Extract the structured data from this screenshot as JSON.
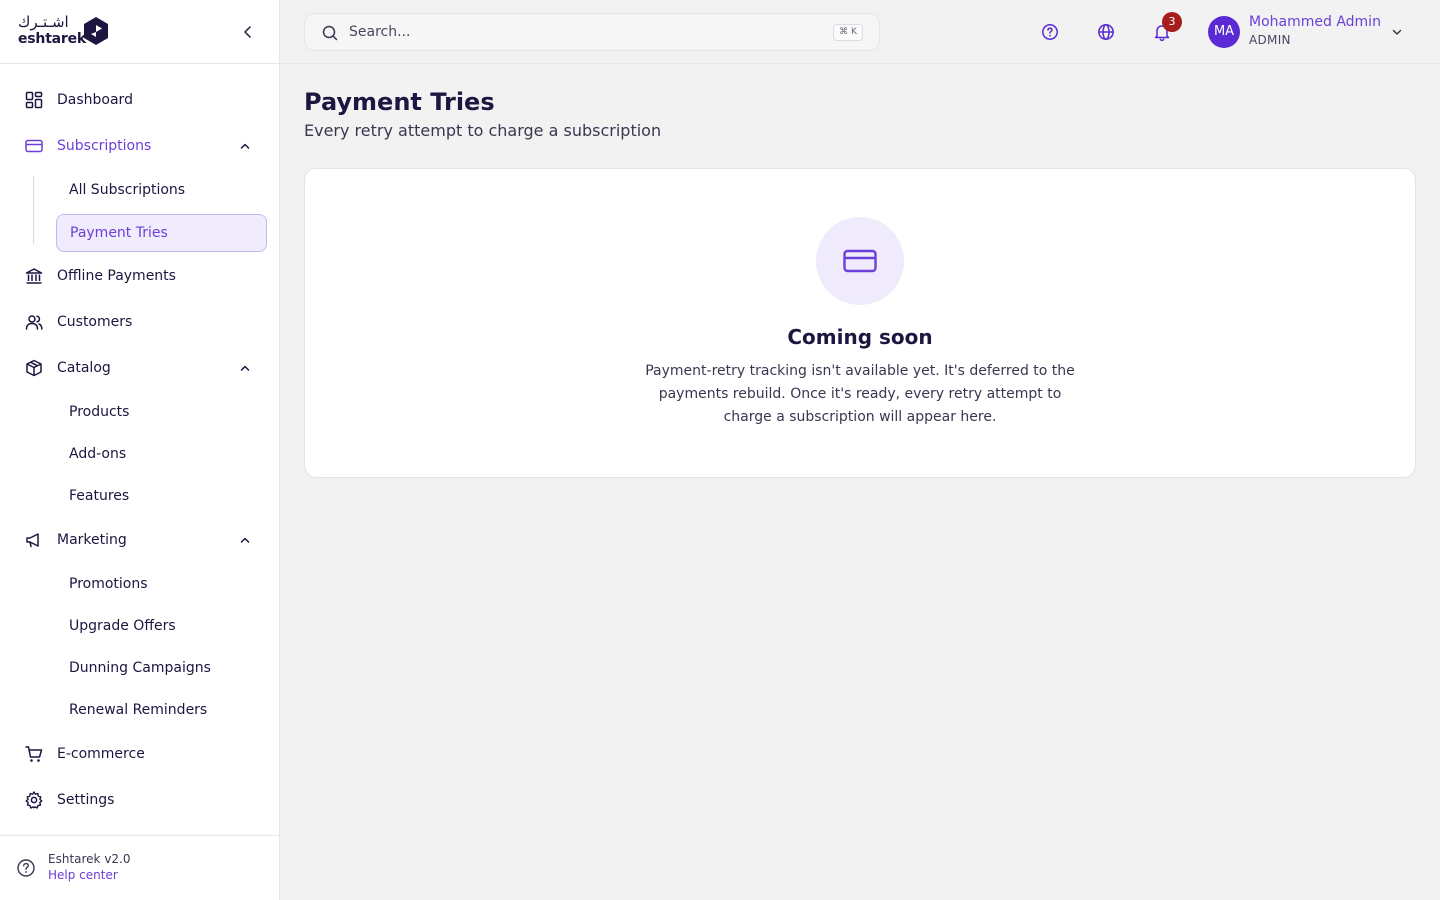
{
  "brand": {
    "arabic": "اشـتـرك",
    "latin": "eshtarek"
  },
  "sidebar": {
    "items": [
      {
        "label": "Dashboard",
        "icon": "dashboard-grid-icon"
      },
      {
        "label": "Subscriptions",
        "icon": "credit-card-icon",
        "expanded": true,
        "children": [
          {
            "label": "All Subscriptions"
          },
          {
            "label": "Payment Tries",
            "active": true
          }
        ]
      },
      {
        "label": "Offline Payments",
        "icon": "bank-icon"
      },
      {
        "label": "Customers",
        "icon": "users-icon"
      },
      {
        "label": "Catalog",
        "icon": "package-icon",
        "expanded": true,
        "children": [
          {
            "label": "Products"
          },
          {
            "label": "Add-ons"
          },
          {
            "label": "Features"
          }
        ]
      },
      {
        "label": "Marketing",
        "icon": "megaphone-icon",
        "expanded": true,
        "children": [
          {
            "label": "Promotions"
          },
          {
            "label": "Upgrade Offers"
          },
          {
            "label": "Dunning Campaigns"
          },
          {
            "label": "Renewal Reminders"
          }
        ]
      },
      {
        "label": "E-commerce",
        "icon": "cart-icon"
      },
      {
        "label": "Settings",
        "icon": "gear-icon"
      }
    ],
    "footer": {
      "version": "Eshtarek v2.0",
      "help": "Help center"
    }
  },
  "header": {
    "search_placeholder": "Search...",
    "shortcut": "⌘ K",
    "notification_count": "3",
    "user": {
      "initials": "MA",
      "name": "Mohammed Admin",
      "role": "ADMIN"
    }
  },
  "main": {
    "title": "Payment Tries",
    "subtitle": "Every retry attempt to charge a subscription",
    "empty_state": {
      "title": "Coming soon",
      "body": "Payment-retry tracking isn't available yet. It's deferred to the payments rebuild. Once it's ready, every retry attempt to charge a subscription will appear here."
    }
  },
  "colors": {
    "accent": "#6b3fd8",
    "text": "#1c1640",
    "badge": "#a61d1d",
    "avatar": "#5a2bd4"
  }
}
